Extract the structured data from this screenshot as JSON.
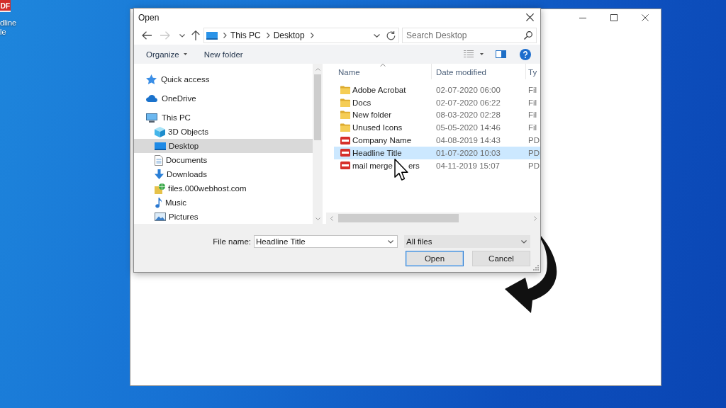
{
  "desktop": {
    "icon_badge": "DF",
    "icon_label_lines": [
      "dline",
      "le"
    ]
  },
  "dialog": {
    "title": "Open",
    "nav_buttons": [
      {
        "kind": "back",
        "disabled": false
      },
      {
        "kind": "forward",
        "disabled": true
      },
      {
        "kind": "recent",
        "disabled": false
      },
      {
        "kind": "up",
        "disabled": false
      }
    ],
    "breadcrumb": [
      "This PC",
      "Desktop"
    ],
    "search": {
      "placeholder": "Search Desktop"
    },
    "toolbar": [
      {
        "kind": "menu",
        "label": "Organize"
      },
      {
        "kind": "button",
        "label": "New folder"
      }
    ],
    "sidebar": {
      "items": [
        {
          "kind": "quick-access",
          "label": "Quick access",
          "selected": false
        },
        {
          "kind": "cloud",
          "label": "OneDrive",
          "selected": false
        },
        {
          "kind": "pc",
          "label": "This PC",
          "selected": false,
          "children": [
            {
              "kind": "cube",
              "label": "3D Objects",
              "selected": false
            },
            {
              "kind": "desktop",
              "label": "Desktop",
              "selected": true
            },
            {
              "kind": "documents",
              "label": "Documents",
              "selected": false
            },
            {
              "kind": "downloads",
              "label": "Downloads",
              "selected": false
            },
            {
              "kind": "web-folder",
              "label": "files.000webhost.com",
              "selected": false
            },
            {
              "kind": "music",
              "label": "Music",
              "selected": false
            },
            {
              "kind": "pictures",
              "label": "Pictures",
              "selected": false
            }
          ]
        }
      ]
    },
    "file_list": {
      "columns": [
        {
          "label": "Name",
          "sorted": true
        },
        {
          "label": "Date modified",
          "sorted": false
        },
        {
          "label": "Ty",
          "sorted": false
        }
      ],
      "rows": [
        {
          "kind": "folder",
          "name": "Adobe Acrobat",
          "date_modified": "02-07-2020 06:00",
          "column_3": "Fil",
          "selected": false
        },
        {
          "kind": "folder",
          "name": "Docs",
          "date_modified": "02-07-2020 06:22",
          "column_3": "Fil",
          "selected": false
        },
        {
          "kind": "folder",
          "name": "New folder",
          "date_modified": "08-03-2020 02:28",
          "column_3": "Fil",
          "selected": false
        },
        {
          "kind": "folder",
          "name": "Unused Icons",
          "date_modified": "05-05-2020 14:46",
          "column_3": "Fil",
          "selected": false
        },
        {
          "kind": "pdf",
          "name": "Company Name",
          "date_modified": "04-08-2019 14:43",
          "column_3": "PD",
          "selected": false
        },
        {
          "kind": "pdf",
          "name": "Headline Title",
          "date_modified": "01-07-2020 10:03",
          "column_3": "PD",
          "selected": true
        },
        {
          "kind": "pdf",
          "name": "mail merge",
          "name_end": "ers",
          "date_modified": "04-11-2019 15:07",
          "column_3": "PD",
          "selected": false
        }
      ]
    },
    "file_name": {
      "label": "File name:",
      "value": "Headline Title"
    },
    "file_type": {
      "value": "All files"
    },
    "buttons": [
      {
        "label": "Open",
        "default": true
      },
      {
        "label": "Cancel",
        "default": false
      }
    ]
  }
}
